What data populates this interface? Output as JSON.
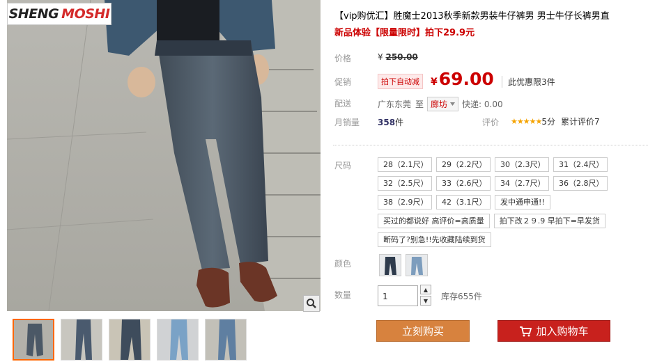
{
  "brand": {
    "logo_part1": "SHENG",
    "logo_part2": "MOSHI"
  },
  "product": {
    "title": "【vip购优汇】胜魔士2013秋季新款男装牛仔裤男 男士牛仔长裤男直",
    "subtitle": "新品体验【限量限时】拍下29.9元"
  },
  "price": {
    "label": "价格",
    "currency": "¥",
    "original": "250.00"
  },
  "promo": {
    "label": "促销",
    "tag": "拍下自动减",
    "currency": "¥",
    "price": "69.00",
    "note": "此优惠限3件"
  },
  "shipping": {
    "label": "配送",
    "from": "广东东莞",
    "to_word": "至",
    "dest": "廊坊",
    "fee": "快递: 0.00"
  },
  "sales": {
    "label": "月销量",
    "count": "358",
    "unit": "件"
  },
  "rating": {
    "label": "评价",
    "stars": "★★★★★",
    "score": "5分",
    "total": "累计评价7"
  },
  "sizes": {
    "label": "尺码",
    "rows": [
      [
        "28（2.1尺）",
        "29（2.2尺）",
        "30（2.3尺）",
        "31（2.4尺）"
      ],
      [
        "32（2.5尺）",
        "33（2.6尺）",
        "34（2.7尺）",
        "36（2.8尺）"
      ],
      [
        "38（2.9尺）",
        "42（3.1尺）",
        "发中通申通!!"
      ],
      [
        "买过的都说好 高评价=高质量",
        "拍下改２９.9 早拍下=早发货"
      ],
      [
        "断码了?别急!!先收藏陆续到货"
      ]
    ]
  },
  "colors": {
    "label": "颜色",
    "items": [
      "dark-blue-jeans",
      "light-blue-jeans"
    ]
  },
  "quantity": {
    "label": "数量",
    "value": "1",
    "stock": "库存655件"
  },
  "actions": {
    "buy_now": "立刻购买",
    "add_cart": "加入购物车"
  },
  "thumbnails": [
    "thumb-1",
    "thumb-2",
    "thumb-3",
    "thumb-4",
    "thumb-5"
  ],
  "accent_colors": {
    "price_red": "#cc0000",
    "buy_orange": "#d7823e",
    "cart_red": "#c8211d"
  }
}
